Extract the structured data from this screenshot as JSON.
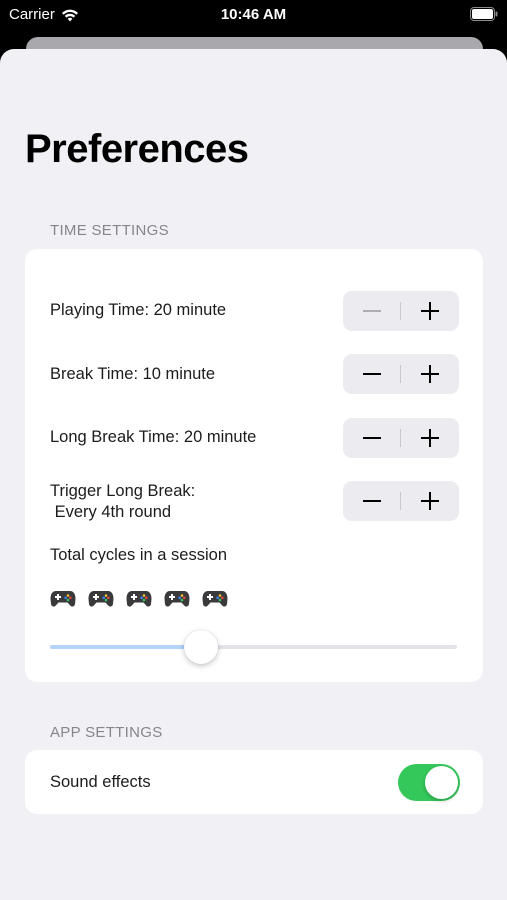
{
  "status_bar": {
    "carrier": "Carrier",
    "time": "10:46 AM"
  },
  "page": {
    "title": "Preferences"
  },
  "time_settings": {
    "header": "TIME SETTINGS",
    "rows": [
      {
        "label": "Playing Time:  20 minute"
      },
      {
        "label": "Break Time:  10 minute"
      },
      {
        "label": "Long Break Time:  20 minute"
      },
      {
        "label": "Trigger Long Break:",
        "label_line2": " Every 4th round"
      }
    ],
    "stepper_minus": "−",
    "stepper_plus": "+",
    "cycles_label": "Total cycles in a session",
    "cycles_count": 5,
    "gamepad_icon": "gamepad-icon",
    "slider_fraction": 0.37
  },
  "app_settings": {
    "header": "APP SETTINGS",
    "sound_label": "Sound effects",
    "sound_enabled": true
  },
  "colors": {
    "toggle_on": "#34c759",
    "slider_fill": "#b3d4fb",
    "stepper_bg": "#ececf0",
    "minus_disabled": "#aeaeb2"
  }
}
